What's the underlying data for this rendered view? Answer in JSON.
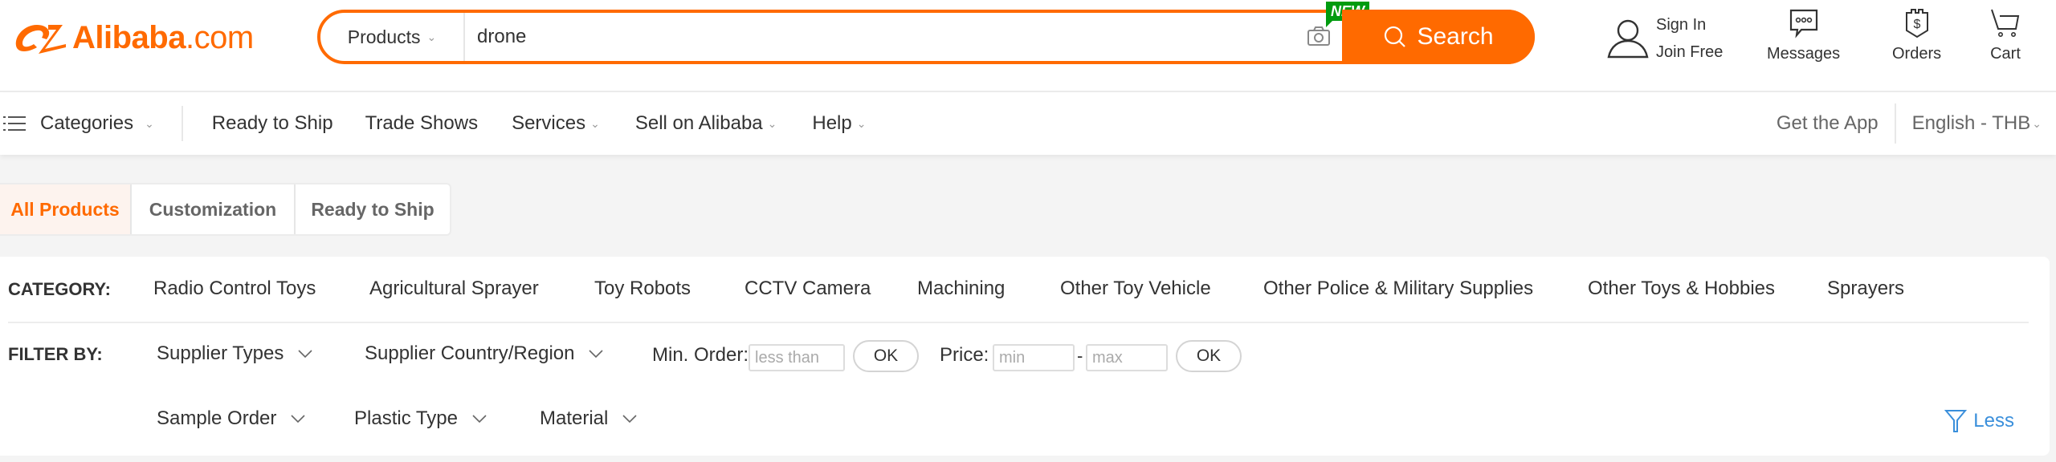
{
  "header": {
    "logo_text": "Alibaba",
    "logo_suffix": ".com",
    "search": {
      "type_label": "Products",
      "query": "drone",
      "new_badge": "NEW",
      "button_label": "Search"
    },
    "account": {
      "sign_in": "Sign In",
      "join_free": "Join Free"
    },
    "items": [
      {
        "label": "Messages",
        "icon": "messages-icon"
      },
      {
        "label": "Orders",
        "icon": "orders-icon"
      },
      {
        "label": "Cart",
        "icon": "cart-icon"
      }
    ]
  },
  "navbar": {
    "categories": "Categories",
    "items": [
      {
        "label": "Ready to Ship"
      },
      {
        "label": "Trade Shows"
      },
      {
        "label": "Services"
      },
      {
        "label": "Sell on Alibaba"
      },
      {
        "label": "Help"
      }
    ],
    "get_app": "Get the App",
    "language": "English - THB"
  },
  "tabs": [
    {
      "label": "All Products",
      "active": true
    },
    {
      "label": "Customization",
      "active": false
    },
    {
      "label": "Ready to Ship",
      "active": false
    }
  ],
  "filters": {
    "category_label": "CATEGORY:",
    "categories": [
      "Radio Control Toys",
      "Agricultural Sprayer",
      "Toy Robots",
      "CCTV Camera",
      "Machining",
      "Other Toy Vehicle",
      "Other Police & Military Supplies",
      "Other Toys & Hobbies",
      "Sprayers"
    ],
    "filter_label": "FILTER BY:",
    "dropdowns_row1": [
      "Supplier Types",
      "Supplier Country/Region"
    ],
    "min_order": {
      "label": "Min. Order:",
      "placeholder": "less than",
      "ok": "OK"
    },
    "price": {
      "label": "Price:",
      "min_placeholder": "min",
      "separator": "-",
      "max_placeholder": "max",
      "ok": "OK"
    },
    "dropdowns_row2": [
      "Sample Order",
      "Plastic Type",
      "Material"
    ],
    "less_label": "Less"
  },
  "colors": {
    "brand": "#ff6a00",
    "new_badge": "#009b0f",
    "link_blue": "#3a8fdb"
  }
}
